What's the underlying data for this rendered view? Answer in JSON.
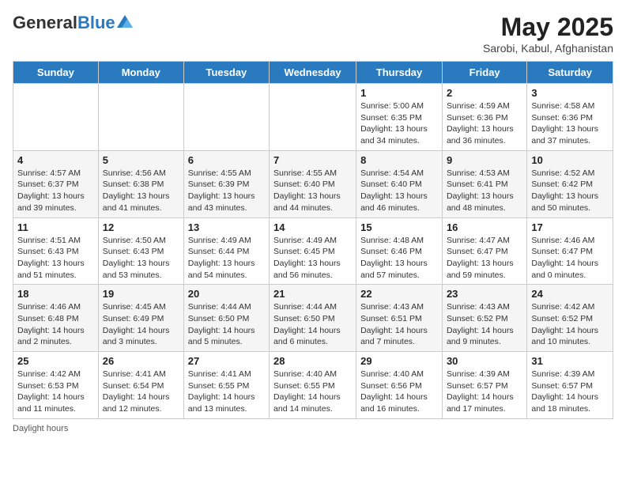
{
  "header": {
    "logo_general": "General",
    "logo_blue": "Blue",
    "month_year": "May 2025",
    "location": "Sarobi, Kabul, Afghanistan"
  },
  "weekdays": [
    "Sunday",
    "Monday",
    "Tuesday",
    "Wednesday",
    "Thursday",
    "Friday",
    "Saturday"
  ],
  "weeks": [
    [
      {
        "day": "",
        "info": ""
      },
      {
        "day": "",
        "info": ""
      },
      {
        "day": "",
        "info": ""
      },
      {
        "day": "",
        "info": ""
      },
      {
        "day": "1",
        "info": "Sunrise: 5:00 AM\nSunset: 6:35 PM\nDaylight: 13 hours\nand 34 minutes."
      },
      {
        "day": "2",
        "info": "Sunrise: 4:59 AM\nSunset: 6:36 PM\nDaylight: 13 hours\nand 36 minutes."
      },
      {
        "day": "3",
        "info": "Sunrise: 4:58 AM\nSunset: 6:36 PM\nDaylight: 13 hours\nand 37 minutes."
      }
    ],
    [
      {
        "day": "4",
        "info": "Sunrise: 4:57 AM\nSunset: 6:37 PM\nDaylight: 13 hours\nand 39 minutes."
      },
      {
        "day": "5",
        "info": "Sunrise: 4:56 AM\nSunset: 6:38 PM\nDaylight: 13 hours\nand 41 minutes."
      },
      {
        "day": "6",
        "info": "Sunrise: 4:55 AM\nSunset: 6:39 PM\nDaylight: 13 hours\nand 43 minutes."
      },
      {
        "day": "7",
        "info": "Sunrise: 4:55 AM\nSunset: 6:40 PM\nDaylight: 13 hours\nand 44 minutes."
      },
      {
        "day": "8",
        "info": "Sunrise: 4:54 AM\nSunset: 6:40 PM\nDaylight: 13 hours\nand 46 minutes."
      },
      {
        "day": "9",
        "info": "Sunrise: 4:53 AM\nSunset: 6:41 PM\nDaylight: 13 hours\nand 48 minutes."
      },
      {
        "day": "10",
        "info": "Sunrise: 4:52 AM\nSunset: 6:42 PM\nDaylight: 13 hours\nand 50 minutes."
      }
    ],
    [
      {
        "day": "11",
        "info": "Sunrise: 4:51 AM\nSunset: 6:43 PM\nDaylight: 13 hours\nand 51 minutes."
      },
      {
        "day": "12",
        "info": "Sunrise: 4:50 AM\nSunset: 6:43 PM\nDaylight: 13 hours\nand 53 minutes."
      },
      {
        "day": "13",
        "info": "Sunrise: 4:49 AM\nSunset: 6:44 PM\nDaylight: 13 hours\nand 54 minutes."
      },
      {
        "day": "14",
        "info": "Sunrise: 4:49 AM\nSunset: 6:45 PM\nDaylight: 13 hours\nand 56 minutes."
      },
      {
        "day": "15",
        "info": "Sunrise: 4:48 AM\nSunset: 6:46 PM\nDaylight: 13 hours\nand 57 minutes."
      },
      {
        "day": "16",
        "info": "Sunrise: 4:47 AM\nSunset: 6:47 PM\nDaylight: 13 hours\nand 59 minutes."
      },
      {
        "day": "17",
        "info": "Sunrise: 4:46 AM\nSunset: 6:47 PM\nDaylight: 14 hours\nand 0 minutes."
      }
    ],
    [
      {
        "day": "18",
        "info": "Sunrise: 4:46 AM\nSunset: 6:48 PM\nDaylight: 14 hours\nand 2 minutes."
      },
      {
        "day": "19",
        "info": "Sunrise: 4:45 AM\nSunset: 6:49 PM\nDaylight: 14 hours\nand 3 minutes."
      },
      {
        "day": "20",
        "info": "Sunrise: 4:44 AM\nSunset: 6:50 PM\nDaylight: 14 hours\nand 5 minutes."
      },
      {
        "day": "21",
        "info": "Sunrise: 4:44 AM\nSunset: 6:50 PM\nDaylight: 14 hours\nand 6 minutes."
      },
      {
        "day": "22",
        "info": "Sunrise: 4:43 AM\nSunset: 6:51 PM\nDaylight: 14 hours\nand 7 minutes."
      },
      {
        "day": "23",
        "info": "Sunrise: 4:43 AM\nSunset: 6:52 PM\nDaylight: 14 hours\nand 9 minutes."
      },
      {
        "day": "24",
        "info": "Sunrise: 4:42 AM\nSunset: 6:52 PM\nDaylight: 14 hours\nand 10 minutes."
      }
    ],
    [
      {
        "day": "25",
        "info": "Sunrise: 4:42 AM\nSunset: 6:53 PM\nDaylight: 14 hours\nand 11 minutes."
      },
      {
        "day": "26",
        "info": "Sunrise: 4:41 AM\nSunset: 6:54 PM\nDaylight: 14 hours\nand 12 minutes."
      },
      {
        "day": "27",
        "info": "Sunrise: 4:41 AM\nSunset: 6:55 PM\nDaylight: 14 hours\nand 13 minutes."
      },
      {
        "day": "28",
        "info": "Sunrise: 4:40 AM\nSunset: 6:55 PM\nDaylight: 14 hours\nand 14 minutes."
      },
      {
        "day": "29",
        "info": "Sunrise: 4:40 AM\nSunset: 6:56 PM\nDaylight: 14 hours\nand 16 minutes."
      },
      {
        "day": "30",
        "info": "Sunrise: 4:39 AM\nSunset: 6:57 PM\nDaylight: 14 hours\nand 17 minutes."
      },
      {
        "day": "31",
        "info": "Sunrise: 4:39 AM\nSunset: 6:57 PM\nDaylight: 14 hours\nand 18 minutes."
      }
    ]
  ],
  "footer": {
    "daylight_hours_label": "Daylight hours"
  }
}
